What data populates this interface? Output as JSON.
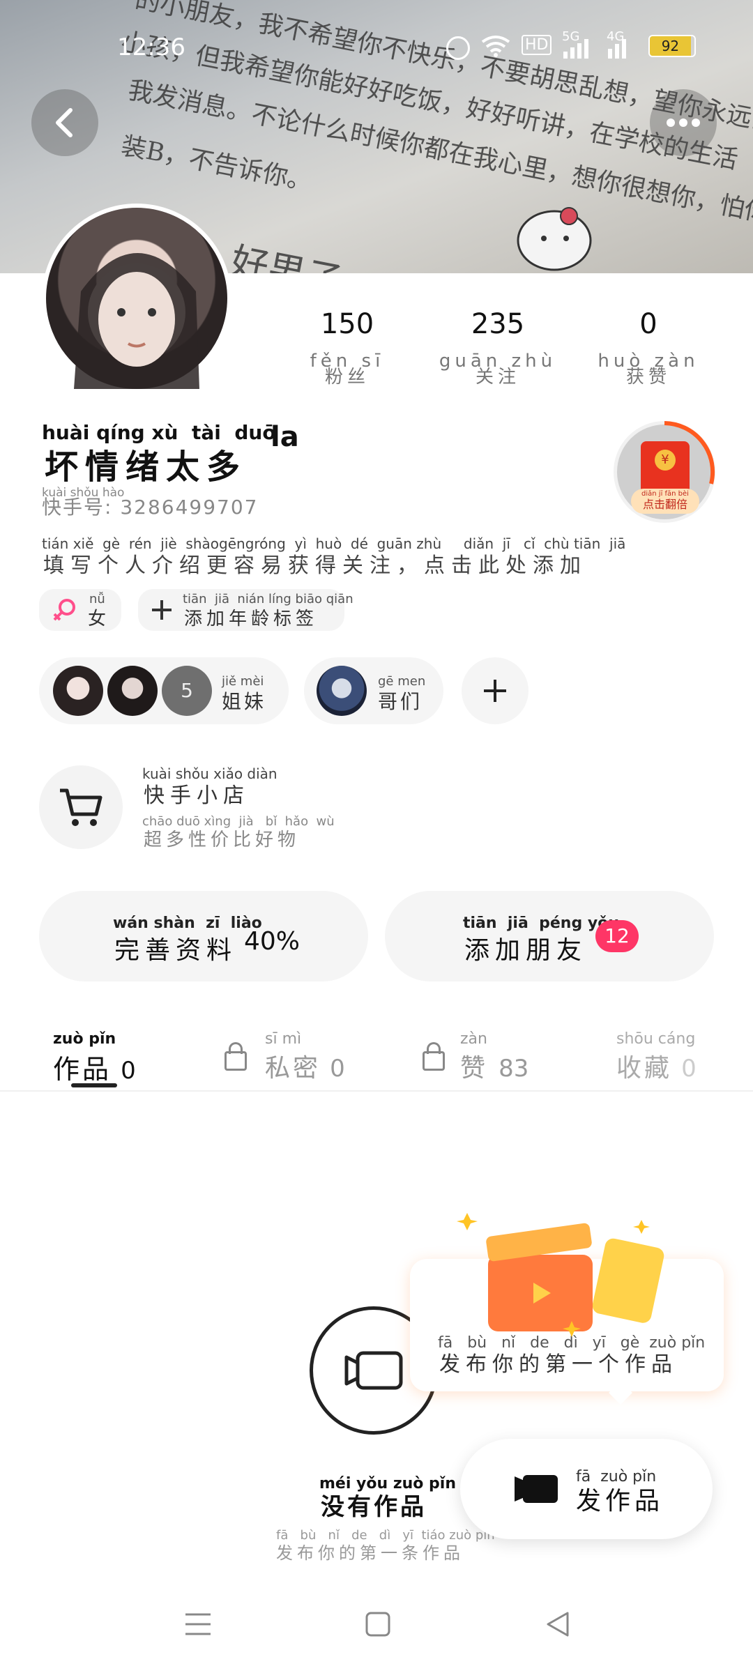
{
  "status_bar": {
    "time": "12:36",
    "battery": "92",
    "net1": "5G",
    "net2": "4G",
    "hd": "HD"
  },
  "header_note_lines": [
    "的小朋友，我不希望你不快乐，不要胡思乱想，望你永远当个快乐",
    "小孩，但我希望你能好好吃饭，好好听讲，在学校的生活",
    "我发消息。不论什么时候你都在我心里，想你很想你，怕你",
    "装B，不告诉你。",
    "好男子"
  ],
  "stats": [
    {
      "value": "150",
      "pinyin": "fěn  sī",
      "label": "粉丝"
    },
    {
      "value": "235",
      "pinyin": "guān zhù",
      "label": "关注"
    },
    {
      "value": "0",
      "pinyin": "huò zàn",
      "label": "获赞"
    }
  ],
  "profile": {
    "name_pinyin": "huài qíng xù  tài  duō",
    "name": "坏情绪太多",
    "name_suffix": "la",
    "id_pinyin": "kuài shǒu hào",
    "id_text": "快手号: 3286499707",
    "bio_pinyin": "tián xiě  gè  rén  jiè  shàogēngróng  yì  huò  dé  guān zhù     diǎn  jī   cǐ  chù tiān  jiā",
    "bio": "填写个人介绍更容易获得关注，点击此处添加",
    "gender_pinyin": "nǚ",
    "gender": "女",
    "age_tag_pinyin": "tiān  jiā  nián líng biāo qiān",
    "age_tag": "添加年龄标签"
  },
  "red_packet": {
    "pinyin": "diǎn  jī  fān bèi",
    "label": "点击翻倍"
  },
  "groups": [
    {
      "pinyin": "jiě  mèi",
      "label": "姐妹",
      "badge": "5"
    },
    {
      "pinyin": "gē  men",
      "label": "哥们"
    }
  ],
  "shop": {
    "title_pinyin": "kuài shǒu xiǎo diàn",
    "title": "快手小店",
    "sub_pinyin": "chāo duō xìng  jià   bǐ  hǎo  wù",
    "subtitle": "超多性价比好物"
  },
  "actions": {
    "complete_pinyin": "wán shàn  zī  liào",
    "complete_label": "完善资料",
    "complete_value": "40%",
    "friends_pinyin": "tiān  jiā  péng yǒu",
    "friends_label": "添加朋友",
    "friends_badge": "12"
  },
  "tabs": [
    {
      "pinyin": "zuò pǐn",
      "label": "作品",
      "count": "0"
    },
    {
      "pinyin": "sī   mì",
      "label": "私密",
      "count": "0"
    },
    {
      "pinyin": "zàn",
      "label": "赞",
      "count": "83"
    },
    {
      "pinyin": "shōu cáng",
      "label": "收藏",
      "count": "0"
    }
  ],
  "empty": {
    "title_pinyin": "méi yǒu zuò pǐn",
    "title": "没有作品",
    "sub_pinyin": "fā   bù   nǐ   de   dì   yī  tiáo zuò pǐn",
    "subtitle": "发布你的第一条作品"
  },
  "tooltip": {
    "pinyin": "fā   bù   nǐ   de   dì   yī   gè  zuò pǐn",
    "text": "发布你的第一个作品"
  },
  "publish": {
    "pinyin": "fā  zuò pǐn",
    "label": "发作品"
  },
  "colors": {
    "accent": "#fe3666",
    "gender": "#ff4f8b",
    "red_packet": "#e8321f",
    "tooltip_orange": "#ff7a3d"
  }
}
